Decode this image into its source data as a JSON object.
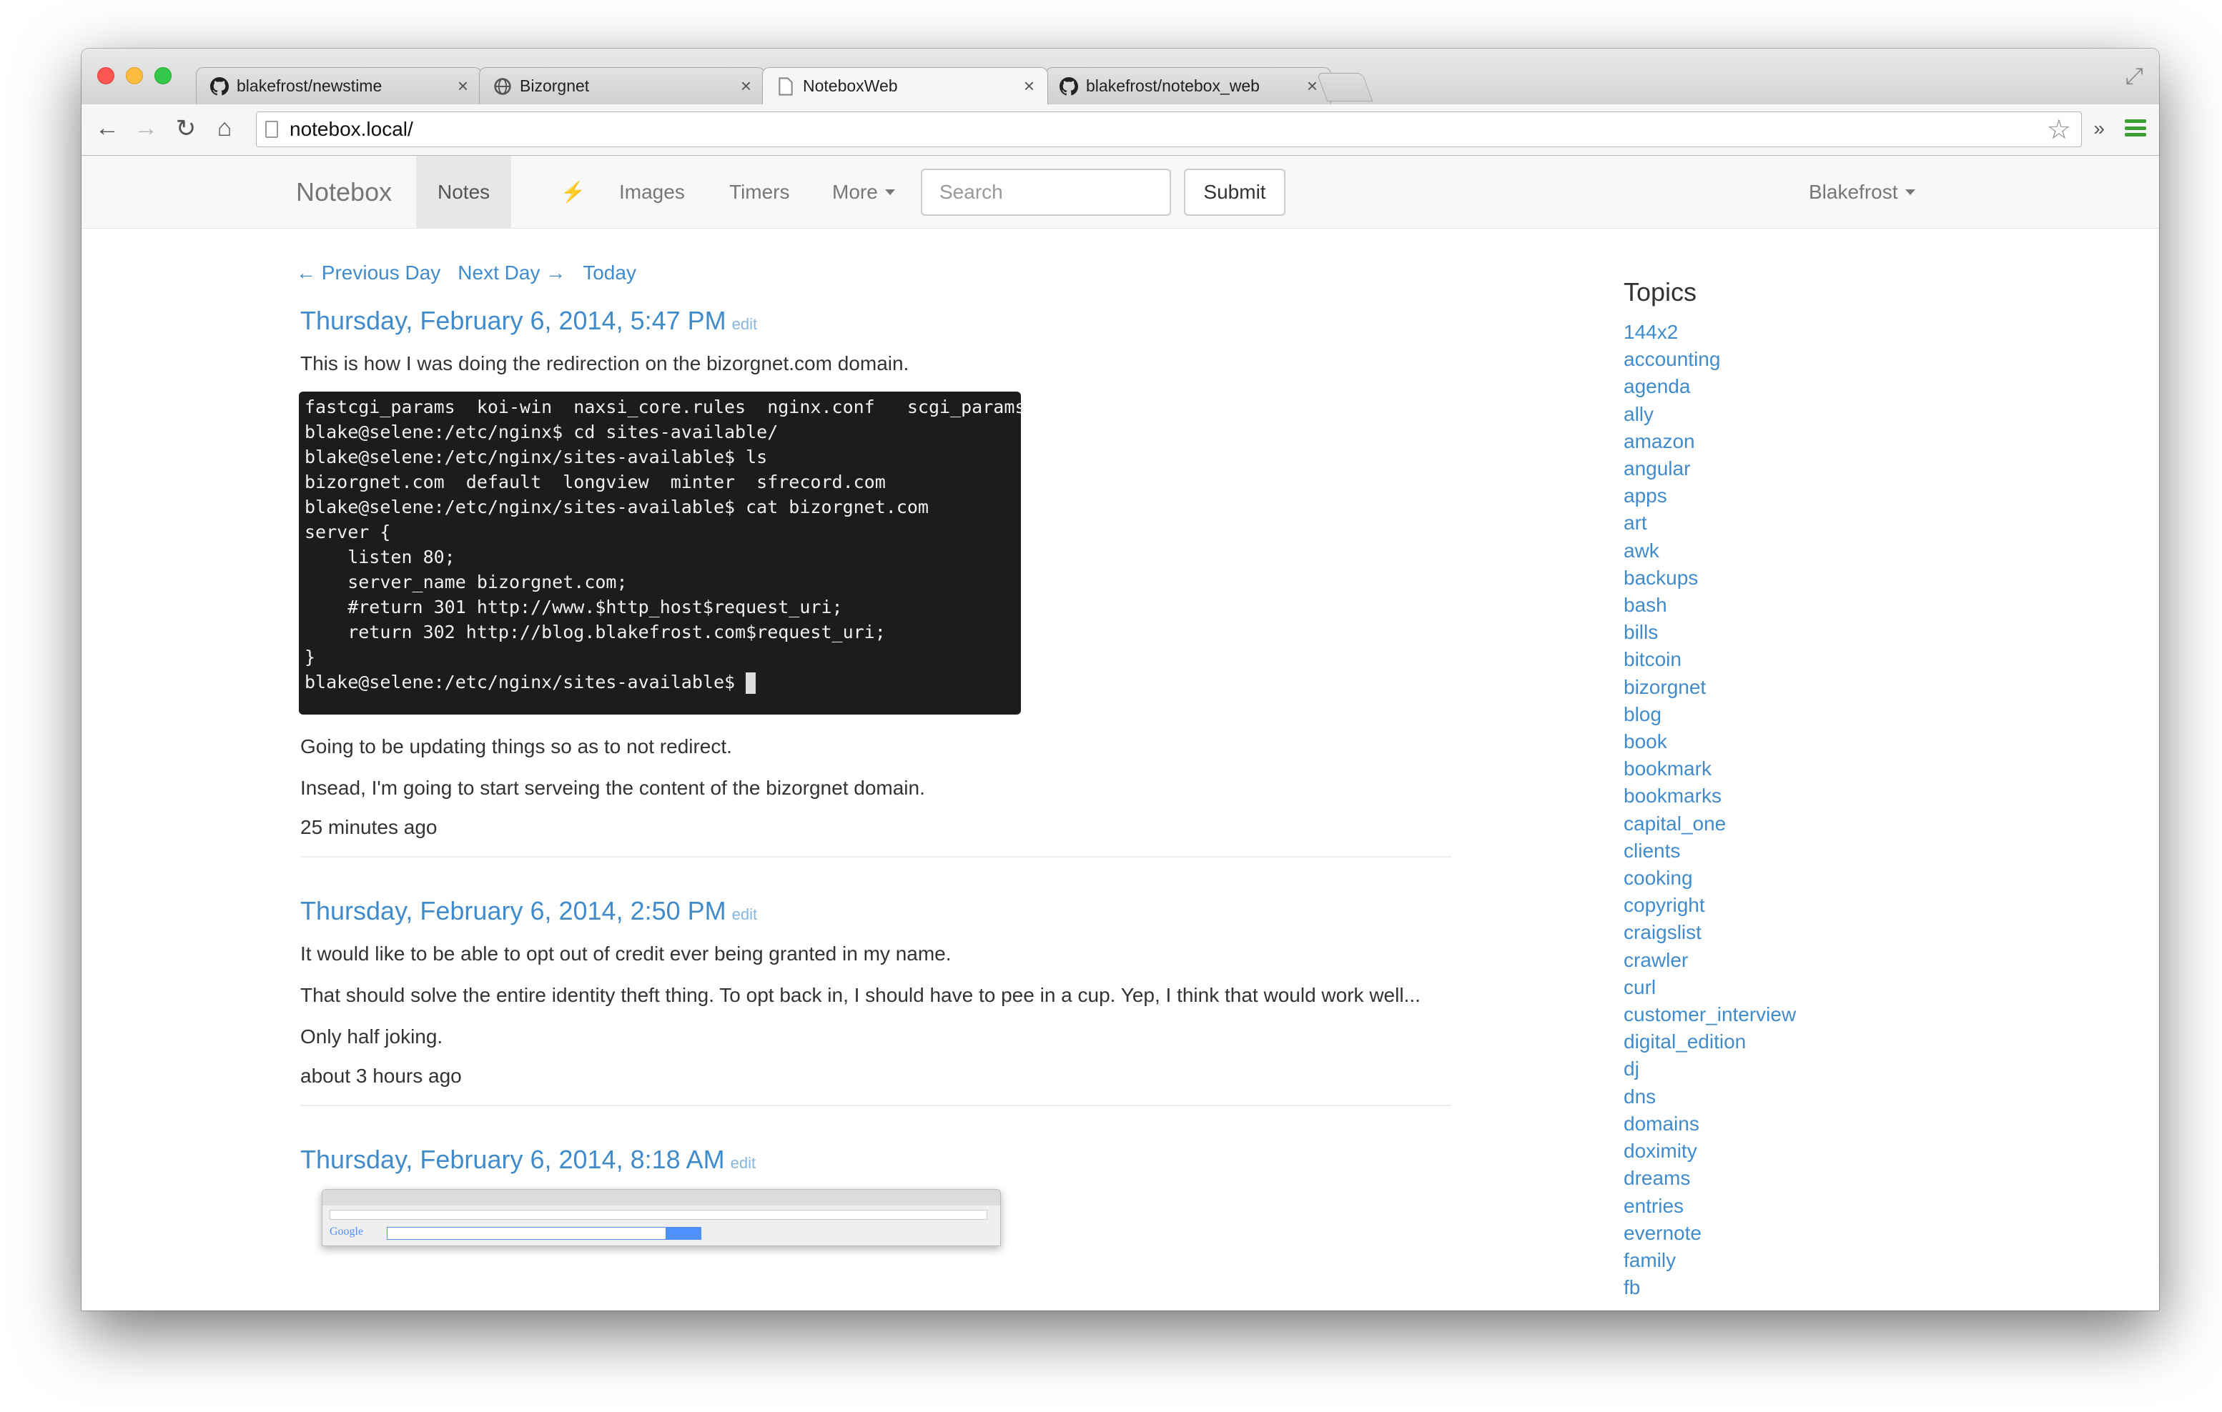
{
  "browser": {
    "tabs": [
      {
        "title": "blakefrost/newstime",
        "icon": "github-icon"
      },
      {
        "title": "Bizorgnet",
        "icon": "globe-icon"
      },
      {
        "title": "NoteboxWeb",
        "icon": "page-icon"
      },
      {
        "title": "blakefrost/notebox_web",
        "icon": "github-icon"
      }
    ],
    "active_tab": 2,
    "url": "notebox.local/"
  },
  "navbar": {
    "brand": "Notebox",
    "links": [
      {
        "label": "Notes",
        "active": true
      },
      {
        "label": "⚡",
        "icon": "bolt-icon"
      },
      {
        "label": "Images"
      },
      {
        "label": "Timers"
      },
      {
        "label": "More"
      }
    ],
    "search_placeholder": "Search",
    "submit_label": "Submit",
    "user": "Blakefrost"
  },
  "daynav": {
    "previous": "← Previous Day",
    "next": "Next Day →",
    "today": "Today"
  },
  "notes": [
    {
      "title": "Thursday, February 6, 2014, 5:47 PM",
      "edit": "edit",
      "intro": "This is how I was doing the redirection on the bizorgnet.com domain.",
      "terminal": "fastcgi_params  koi-win  naxsi_core.rules  nginx.conf   scgi_params\nblake@selene:/etc/nginx$ cd sites-available/\nblake@selene:/etc/nginx/sites-available$ ls\nbizorgnet.com  default  longview  minter  sfrecord.com\nblake@selene:/etc/nginx/sites-available$ cat bizorgnet.com\nserver {\n    listen 80;\n    server_name bizorgnet.com;\n    #return 301 http://www.$http_host$request_uri;\n    return 302 http://blog.blakefrost.com$request_uri;\n}\nblake@selene:/etc/nginx/sites-available$ ",
      "paragraphs": [
        "Going to be updating things so as to not redirect.",
        "Insead, I'm going to start serveing the content of the bizorgnet domain."
      ],
      "ago": "25 minutes ago"
    },
    {
      "title": "Thursday, February 6, 2014, 2:50 PM",
      "edit": "edit",
      "paragraphs": [
        "It would like to be able to opt out of credit ever being granted in my name.",
        "That should solve the entire identity theft thing. To opt back in, I should have to pee in a cup. Yep, I think that would work well...",
        "Only half joking."
      ],
      "ago": "about 3 hours ago"
    },
    {
      "title": "Thursday, February 6, 2014, 8:18 AM",
      "edit": "edit",
      "thumb_logo": "Google"
    }
  ],
  "sidebar": {
    "title": "Topics",
    "topics": [
      "144x2",
      "accounting",
      "agenda",
      "ally",
      "amazon",
      "angular",
      "apps",
      "art",
      "awk",
      "backups",
      "bash",
      "bills",
      "bitcoin",
      "bizorgnet",
      "blog",
      "book",
      "bookmark",
      "bookmarks",
      "capital_one",
      "clients",
      "cooking",
      "copyright",
      "craigslist",
      "crawler",
      "curl",
      "customer_interview",
      "digital_edition",
      "dj",
      "dns",
      "domains",
      "doximity",
      "dreams",
      "entries",
      "evernote",
      "family",
      "fb"
    ]
  }
}
